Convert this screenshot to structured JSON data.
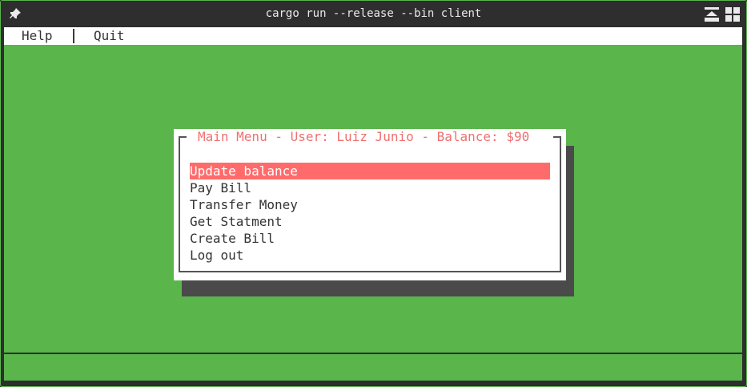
{
  "window": {
    "title": "cargo run --release --bin client"
  },
  "menubar": {
    "help_label": "Help",
    "quit_label": "Quit"
  },
  "dialog": {
    "title": "Main Menu - User: Luiz Junio - Balance: $90",
    "options": [
      {
        "label": "Update balance",
        "selected": true
      },
      {
        "label": "Pay Bill",
        "selected": false
      },
      {
        "label": "Transfer Money",
        "selected": false
      },
      {
        "label": "Get Statment",
        "selected": false
      },
      {
        "label": "Create Bill",
        "selected": false
      },
      {
        "label": "Log out",
        "selected": false
      }
    ]
  },
  "icons": {
    "pin": "pin-icon",
    "minmax": "maximize-icon",
    "tile": "tile-icon"
  },
  "colors": {
    "terminal_bg": "#5ab54b",
    "titlebar_bg": "#2e2e2e",
    "highlight": "#ff6b6b",
    "dialog_title": "#f07070",
    "shadow": "#4a4a4a"
  }
}
